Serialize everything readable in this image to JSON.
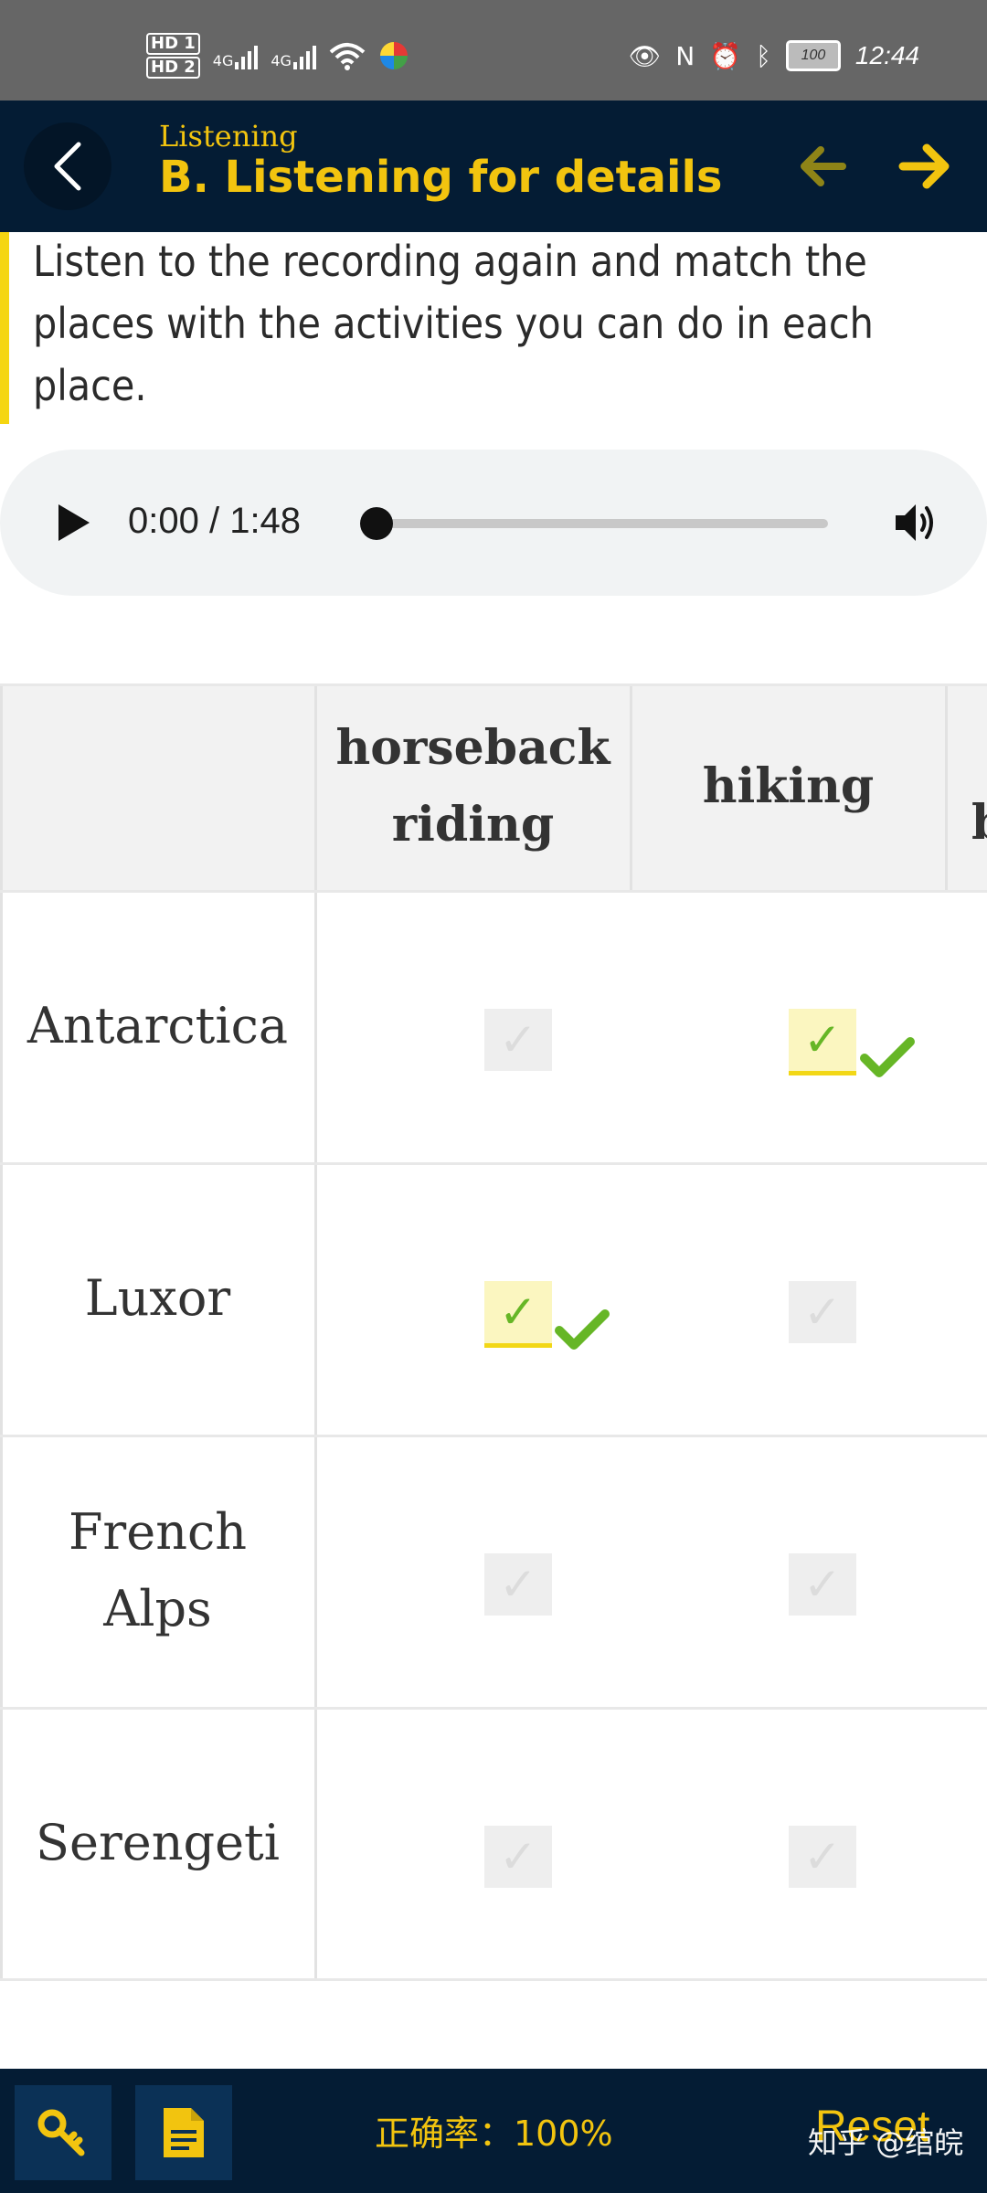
{
  "status_bar": {
    "hd1": "HD 1",
    "hd2": "HD 2",
    "net1": "4G",
    "net2": "4G",
    "battery": "100",
    "time": "12:44"
  },
  "header": {
    "section": "Listening",
    "title": "B. Listening for details"
  },
  "instruction": "Listen to the recording again and match the places with the activities you can do in each place.",
  "player": {
    "time": "0:00 / 1:48",
    "progress": 0
  },
  "table": {
    "columns": [
      "horseback riding",
      "hiking",
      "b"
    ],
    "rows": [
      {
        "place": "Antarctica",
        "selections": [
          false,
          true
        ],
        "correct": [
          false,
          true
        ]
      },
      {
        "place": "Luxor",
        "selections": [
          true,
          false
        ],
        "correct": [
          true,
          false
        ]
      },
      {
        "place": "French Alps",
        "selections": [
          false,
          false
        ],
        "correct": [
          false,
          false
        ]
      },
      {
        "place": "Serengeti",
        "selections": [
          false,
          false
        ],
        "correct": [
          false,
          false
        ]
      }
    ],
    "check_glyph": "✓"
  },
  "bottom_bar": {
    "score": "正确率：100%",
    "reset": "Reset",
    "watermark": "知乎 @绾皖"
  },
  "colors": {
    "header_bg": "#041c34",
    "accent_yellow": "#f2c40f",
    "correct_green": "#66b626"
  }
}
